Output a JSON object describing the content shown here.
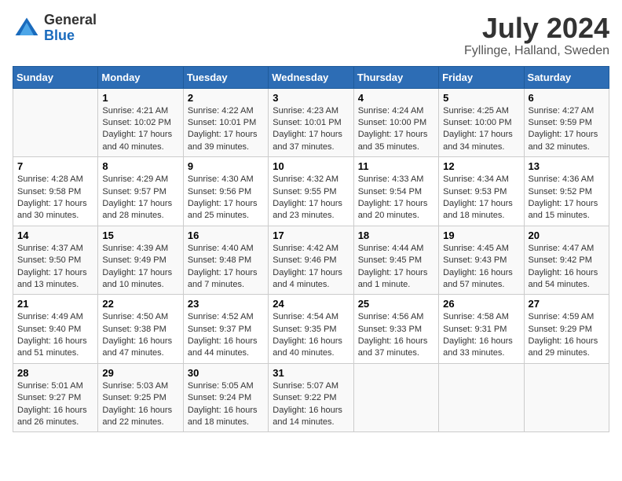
{
  "header": {
    "logo_general": "General",
    "logo_blue": "Blue",
    "month_year": "July 2024",
    "location": "Fyllinge, Halland, Sweden"
  },
  "days_of_week": [
    "Sunday",
    "Monday",
    "Tuesday",
    "Wednesday",
    "Thursday",
    "Friday",
    "Saturday"
  ],
  "weeks": [
    [
      {
        "day": "",
        "info": ""
      },
      {
        "day": "1",
        "info": "Sunrise: 4:21 AM\nSunset: 10:02 PM\nDaylight: 17 hours\nand 40 minutes."
      },
      {
        "day": "2",
        "info": "Sunrise: 4:22 AM\nSunset: 10:01 PM\nDaylight: 17 hours\nand 39 minutes."
      },
      {
        "day": "3",
        "info": "Sunrise: 4:23 AM\nSunset: 10:01 PM\nDaylight: 17 hours\nand 37 minutes."
      },
      {
        "day": "4",
        "info": "Sunrise: 4:24 AM\nSunset: 10:00 PM\nDaylight: 17 hours\nand 35 minutes."
      },
      {
        "day": "5",
        "info": "Sunrise: 4:25 AM\nSunset: 10:00 PM\nDaylight: 17 hours\nand 34 minutes."
      },
      {
        "day": "6",
        "info": "Sunrise: 4:27 AM\nSunset: 9:59 PM\nDaylight: 17 hours\nand 32 minutes."
      }
    ],
    [
      {
        "day": "7",
        "info": "Sunrise: 4:28 AM\nSunset: 9:58 PM\nDaylight: 17 hours\nand 30 minutes."
      },
      {
        "day": "8",
        "info": "Sunrise: 4:29 AM\nSunset: 9:57 PM\nDaylight: 17 hours\nand 28 minutes."
      },
      {
        "day": "9",
        "info": "Sunrise: 4:30 AM\nSunset: 9:56 PM\nDaylight: 17 hours\nand 25 minutes."
      },
      {
        "day": "10",
        "info": "Sunrise: 4:32 AM\nSunset: 9:55 PM\nDaylight: 17 hours\nand 23 minutes."
      },
      {
        "day": "11",
        "info": "Sunrise: 4:33 AM\nSunset: 9:54 PM\nDaylight: 17 hours\nand 20 minutes."
      },
      {
        "day": "12",
        "info": "Sunrise: 4:34 AM\nSunset: 9:53 PM\nDaylight: 17 hours\nand 18 minutes."
      },
      {
        "day": "13",
        "info": "Sunrise: 4:36 AM\nSunset: 9:52 PM\nDaylight: 17 hours\nand 15 minutes."
      }
    ],
    [
      {
        "day": "14",
        "info": "Sunrise: 4:37 AM\nSunset: 9:50 PM\nDaylight: 17 hours\nand 13 minutes."
      },
      {
        "day": "15",
        "info": "Sunrise: 4:39 AM\nSunset: 9:49 PM\nDaylight: 17 hours\nand 10 minutes."
      },
      {
        "day": "16",
        "info": "Sunrise: 4:40 AM\nSunset: 9:48 PM\nDaylight: 17 hours\nand 7 minutes."
      },
      {
        "day": "17",
        "info": "Sunrise: 4:42 AM\nSunset: 9:46 PM\nDaylight: 17 hours\nand 4 minutes."
      },
      {
        "day": "18",
        "info": "Sunrise: 4:44 AM\nSunset: 9:45 PM\nDaylight: 17 hours\nand 1 minute."
      },
      {
        "day": "19",
        "info": "Sunrise: 4:45 AM\nSunset: 9:43 PM\nDaylight: 16 hours\nand 57 minutes."
      },
      {
        "day": "20",
        "info": "Sunrise: 4:47 AM\nSunset: 9:42 PM\nDaylight: 16 hours\nand 54 minutes."
      }
    ],
    [
      {
        "day": "21",
        "info": "Sunrise: 4:49 AM\nSunset: 9:40 PM\nDaylight: 16 hours\nand 51 minutes."
      },
      {
        "day": "22",
        "info": "Sunrise: 4:50 AM\nSunset: 9:38 PM\nDaylight: 16 hours\nand 47 minutes."
      },
      {
        "day": "23",
        "info": "Sunrise: 4:52 AM\nSunset: 9:37 PM\nDaylight: 16 hours\nand 44 minutes."
      },
      {
        "day": "24",
        "info": "Sunrise: 4:54 AM\nSunset: 9:35 PM\nDaylight: 16 hours\nand 40 minutes."
      },
      {
        "day": "25",
        "info": "Sunrise: 4:56 AM\nSunset: 9:33 PM\nDaylight: 16 hours\nand 37 minutes."
      },
      {
        "day": "26",
        "info": "Sunrise: 4:58 AM\nSunset: 9:31 PM\nDaylight: 16 hours\nand 33 minutes."
      },
      {
        "day": "27",
        "info": "Sunrise: 4:59 AM\nSunset: 9:29 PM\nDaylight: 16 hours\nand 29 minutes."
      }
    ],
    [
      {
        "day": "28",
        "info": "Sunrise: 5:01 AM\nSunset: 9:27 PM\nDaylight: 16 hours\nand 26 minutes."
      },
      {
        "day": "29",
        "info": "Sunrise: 5:03 AM\nSunset: 9:25 PM\nDaylight: 16 hours\nand 22 minutes."
      },
      {
        "day": "30",
        "info": "Sunrise: 5:05 AM\nSunset: 9:24 PM\nDaylight: 16 hours\nand 18 minutes."
      },
      {
        "day": "31",
        "info": "Sunrise: 5:07 AM\nSunset: 9:22 PM\nDaylight: 16 hours\nand 14 minutes."
      },
      {
        "day": "",
        "info": ""
      },
      {
        "day": "",
        "info": ""
      },
      {
        "day": "",
        "info": ""
      }
    ]
  ]
}
